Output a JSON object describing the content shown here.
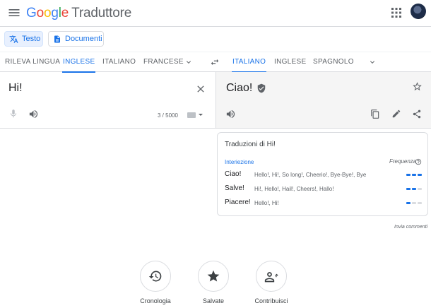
{
  "header": {
    "app_name": "Traduttore",
    "logo_letters": [
      "G",
      "o",
      "o",
      "g",
      "l",
      "e"
    ]
  },
  "modes": [
    {
      "label": "Testo",
      "icon": "translate-icon",
      "active": true
    },
    {
      "label": "Documenti",
      "icon": "document-icon",
      "active": false
    }
  ],
  "source_langs": [
    "RILEVA LINGUA",
    "INGLESE",
    "ITALIANO",
    "FRANCESE"
  ],
  "source_selected": "INGLESE",
  "target_langs": [
    "ITALIANO",
    "INGLESE",
    "SPAGNOLO"
  ],
  "target_selected": "ITALIANO",
  "source": {
    "text": "Hi!",
    "char_count": "3 / 5000"
  },
  "target": {
    "text": "Ciao!"
  },
  "translations": {
    "title": "Traduzioni di Hi!",
    "part_of_speech": "Interiezione",
    "frequency_label": "Frequenza",
    "rows": [
      {
        "word": "Ciao!",
        "synonyms": "Hello!, Hi!, So long!, Cheerio!, Bye-Bye!, Bye",
        "frequency": 3
      },
      {
        "word": "Salve!",
        "synonyms": "Hi!, Hello!, Hail!, Cheers!, Hallo!",
        "frequency": 2
      },
      {
        "word": "Piacere!",
        "synonyms": "Hello!, Hi!",
        "frequency": 1
      }
    ]
  },
  "feedback": "Invia commenti",
  "bottom_actions": [
    {
      "label": "Cronologia",
      "icon": "history-icon"
    },
    {
      "label": "Salvate",
      "icon": "star-icon"
    },
    {
      "label": "Contribuisci",
      "icon": "contribute-icon"
    }
  ],
  "colors": {
    "accent": "#1a73e8",
    "accent_bg": "#e8f0fe",
    "target_bg": "#f5f5f5"
  }
}
